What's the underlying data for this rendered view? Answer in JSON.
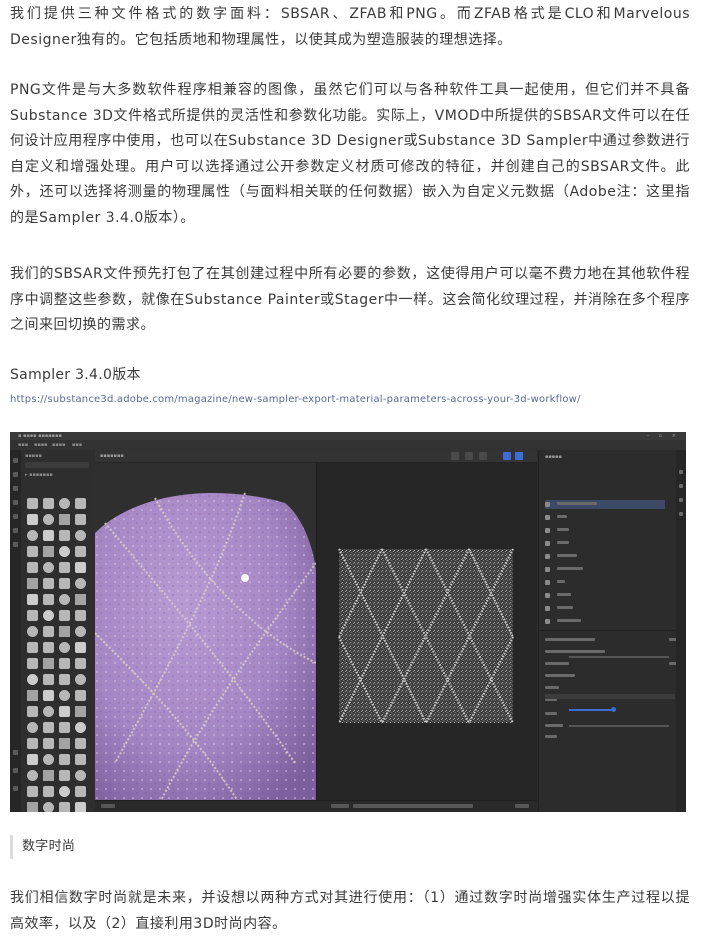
{
  "paragraphs": {
    "p1": "我们提供三种文件格式的数字面料：SBSAR、ZFAB和PNG。而ZFAB格式是CLO和Marvelous Designer独有的。它包括质地和物理属性，以使其成为塑造服装的理想选择。",
    "p2": "PNG文件是与大多数软件程序相兼容的图像，虽然它们可以与各种软件工具一起使用，但它们并不具备Substance 3D文件格式所提供的灵活性和参数化功能。实际上，VMOD中所提供的SBSAR文件可以在任何设计应用程序中使用，也可以在Substance 3D Designer或Substance 3D Sampler中通过参数进行自定义和增强处理。用户可以选择通过公开参数定义材质可修改的特征，并创建自己的SBSAR文件。此外，还可以选择将测量的物理属性（与面料相关联的任何数据）嵌入为自定义元数据（Adobe注：这里指的是Sampler 3.4.0版本）。",
    "p3": "我们的SBSAR文件预先打包了在其创建过程中所有必要的参数，这使得用户可以毫不费力地在其他软件程序中调整这些参数，就像在Substance Painter或Stager中一样。这会简化纹理过程，并消除在多个程序之间来回切换的需求。",
    "p4": "我们相信数字时尚就是未来，并设想以两种方式对其进行使用：（1）通过数字时尚增强实体生产过程以提高效率，以及（2）直接利用3D时尚内容。"
  },
  "section": {
    "heading": "Sampler 3.4.0版本",
    "link": "https://substance3d.adobe.com/magazine/new-sampler-export-material-parameters-across-your-3d-workflow/"
  },
  "quote": {
    "text": "数字时尚"
  },
  "screenshot": {
    "colors": {
      "fabric": "#a98bc7",
      "fabric_dark": "#8e6fb0",
      "stitch": "#d8cfc2",
      "accent": "#3b6fd6"
    },
    "icons": [
      "asset-thumbnail-icon",
      "layer-icon",
      "view-toggle-icon",
      "slider-knob-icon"
    ]
  }
}
